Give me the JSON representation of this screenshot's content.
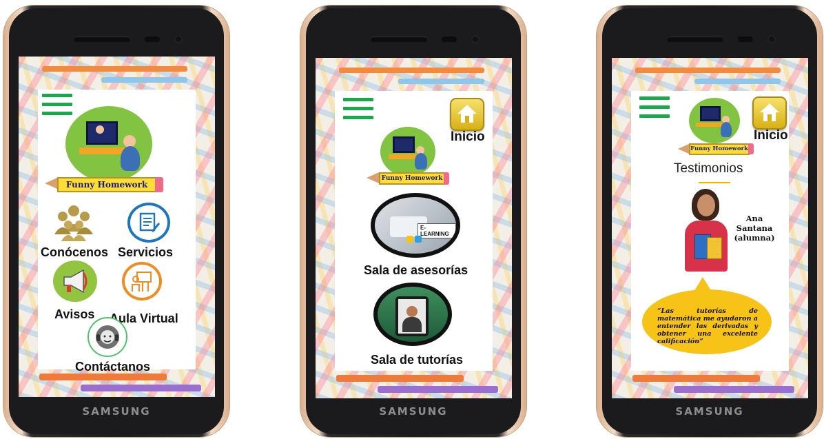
{
  "brand": "SAMSUNG",
  "logo_text": "Funny Homework",
  "phone1": {
    "items": [
      {
        "label": "Conócenos",
        "icon": "group-icon"
      },
      {
        "label": "Servicios",
        "icon": "document-pen-icon"
      },
      {
        "label": "Avisos",
        "icon": "megaphone-icon"
      },
      {
        "label": "Aula Virtual",
        "icon": "teacher-board-icon"
      },
      {
        "label": "Contáctanos",
        "icon": "headset-support-icon"
      }
    ]
  },
  "phone2": {
    "home_label": "Inicio",
    "rooms": [
      {
        "label": "Sala de asesorías",
        "badge": "E-LEARNING"
      },
      {
        "label": "Sala de tutorías"
      }
    ]
  },
  "phone3": {
    "home_label": "Inicio",
    "section_title": "Testimonios",
    "person_name": "Ana Santana",
    "person_role": "(alumna)",
    "quote": "“Las tutorías de matemática me ayudaron a entender las derivadas y obtener una excelente calificación”"
  },
  "colors": {
    "menu_green": "#19a84a",
    "logo_green": "#82c341",
    "accent_yellow": "#f7c316"
  }
}
